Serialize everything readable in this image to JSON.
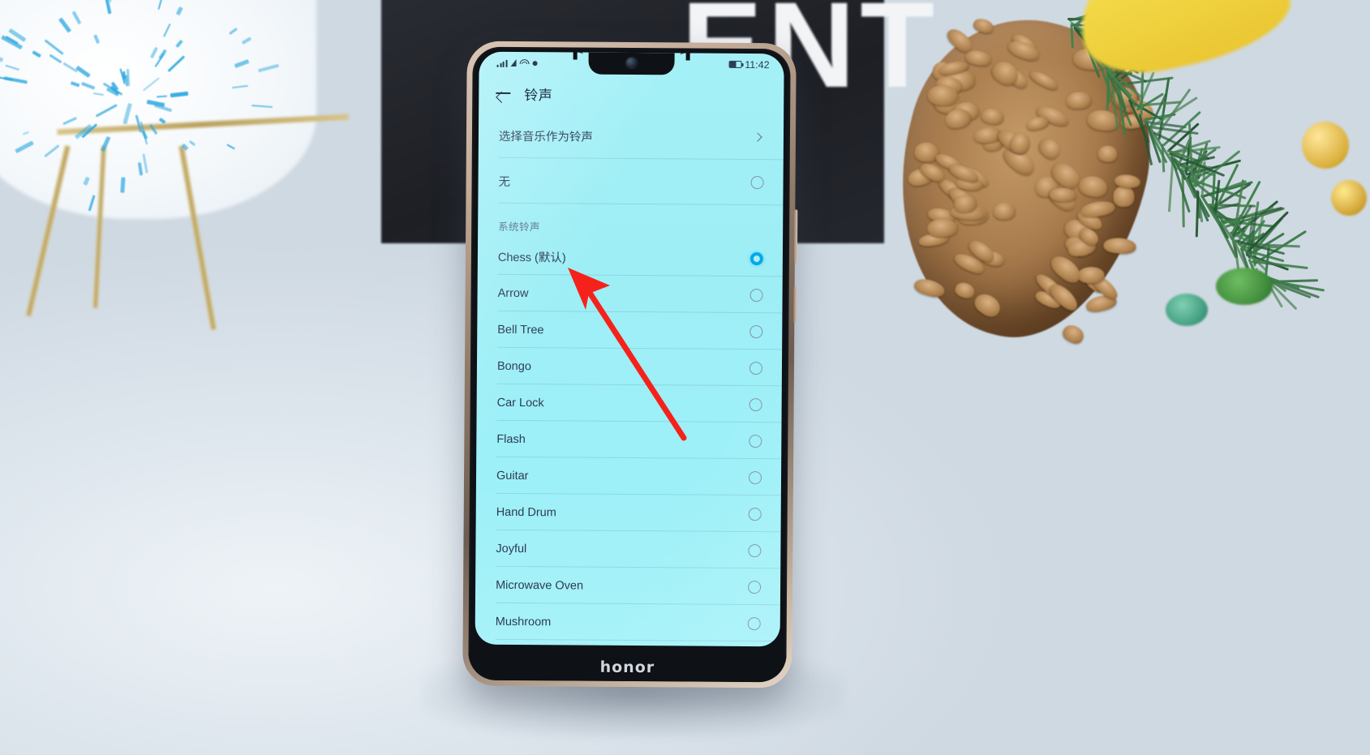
{
  "scene": {
    "background_letters": "ENT",
    "surface_color": "#e4ebf1"
  },
  "device": {
    "brand_logo": "honor",
    "accent_color": "#05A9E8",
    "screen_bg": "#9EEEF6"
  },
  "statusbar": {
    "signal_icon": "signal-bars-icon",
    "data_icon": "data-triangle-icon",
    "wifi_icon": "wifi-icon",
    "dot_icon": "dot-icon",
    "battery_icon": "battery-icon",
    "time": "11:42"
  },
  "appbar": {
    "back_icon": "back-arrow-icon",
    "title": "铃声"
  },
  "top_actions": [
    {
      "label": "选择音乐作为铃声",
      "chevron": "chevron-right-icon"
    }
  ],
  "none_option": {
    "label": "无",
    "selected": false
  },
  "section": {
    "title": "系统铃声"
  },
  "ringtones": [
    {
      "label": "Chess (默认)",
      "selected": true
    },
    {
      "label": "Arrow",
      "selected": false
    },
    {
      "label": "Bell Tree",
      "selected": false
    },
    {
      "label": "Bongo",
      "selected": false
    },
    {
      "label": "Car Lock",
      "selected": false
    },
    {
      "label": "Flash",
      "selected": false
    },
    {
      "label": "Guitar",
      "selected": false
    },
    {
      "label": "Hand Drum",
      "selected": false
    },
    {
      "label": "Joyful",
      "selected": false
    },
    {
      "label": "Microwave Oven",
      "selected": false
    },
    {
      "label": "Mushroom",
      "selected": false
    }
  ],
  "annotation": {
    "type": "arrow",
    "color": "#F5221B",
    "points_at": "Chess (默认)"
  }
}
